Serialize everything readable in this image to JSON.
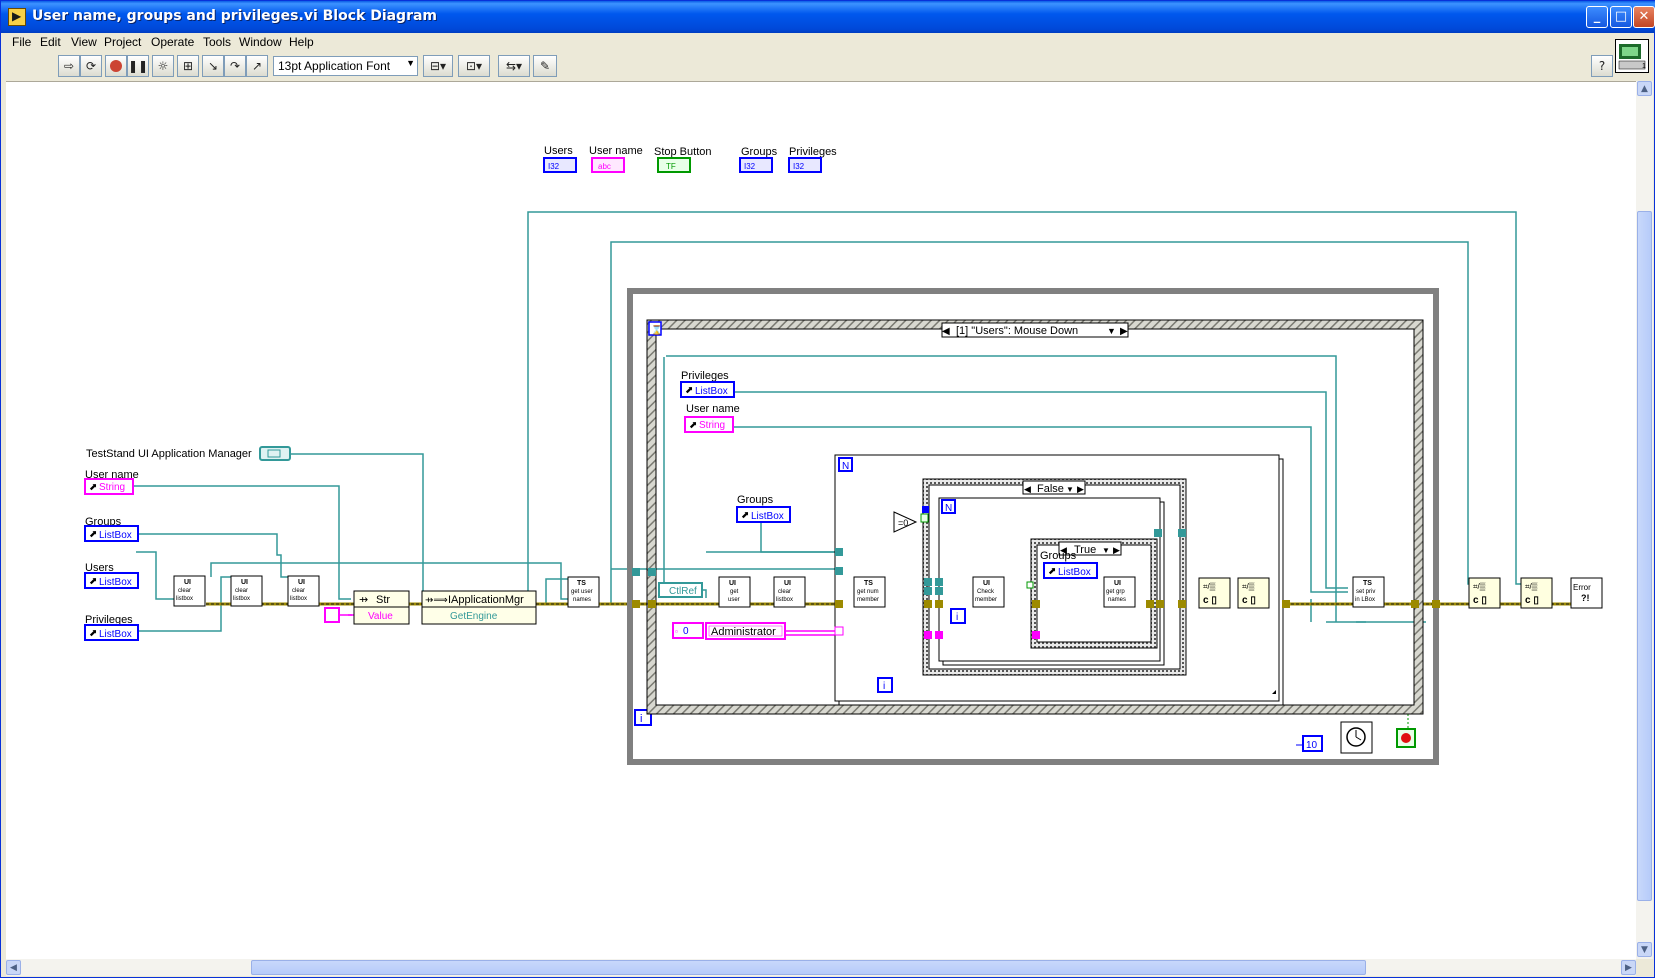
{
  "window": {
    "title": "User name, groups and privileges.vi Block Diagram"
  },
  "menu": [
    "File",
    "Edit",
    "View",
    "Project",
    "Operate",
    "Tools",
    "Window",
    "Help"
  ],
  "toolbar": {
    "font": "13pt Application Font"
  },
  "colors": {
    "wire_teal": "#339999",
    "wire_pink": "#ff00ff",
    "wire_error": "#9c8a00",
    "int_blue": "#0000ff",
    "bool_green": "#009900"
  },
  "terminals": [
    {
      "label": "Users",
      "type": "I32"
    },
    {
      "label": "User name",
      "type": "abc"
    },
    {
      "label": "Stop Button",
      "type": "TF"
    },
    {
      "label": "Groups",
      "type": "I32"
    },
    {
      "label": "Privileges",
      "type": "I32"
    }
  ],
  "left_refs": {
    "app_manager": "TestStand UI Application Manager",
    "user_name": {
      "label": "User name",
      "type": "String"
    },
    "groups": {
      "label": "Groups",
      "type": "ListBox"
    },
    "users": {
      "label": "Users",
      "type": "ListBox"
    },
    "privileges": {
      "label": "Privileges",
      "type": "ListBox"
    }
  },
  "nodes": {
    "ui": "UI",
    "clear": [
      "clear",
      "listbox"
    ],
    "str": "Str",
    "value": "Value",
    "iapp": "IApplicationMgr",
    "getengine": "GetEngine",
    "ts": "TS",
    "get_user_names": [
      "get user",
      "names"
    ],
    "get_user": [
      "get",
      "user"
    ],
    "get_num_member": [
      "get num",
      "member"
    ],
    "check_member": [
      "Check",
      "member"
    ],
    "get_grp_names": [
      "get grp",
      "names"
    ],
    "set_priv": [
      "set priv",
      "in LBox"
    ],
    "error": [
      "Error",
      "?!"
    ]
  },
  "event_case": "[1] \"Users\": Mouse Down",
  "inner": {
    "privileges": {
      "label": "Privileges",
      "type": "ListBox"
    },
    "user_name": {
      "label": "User name",
      "type": "String"
    },
    "groups": {
      "label": "Groups",
      "type": "ListBox"
    },
    "groups2": {
      "label": "Groups",
      "type": "ListBox"
    },
    "ctlref": "CtlRef",
    "const0": "0",
    "admin": "Administrator",
    "case_false": "False",
    "case_true": "True",
    "eq0": "=0",
    "n": "N",
    "i": "i",
    "wait": "10"
  }
}
